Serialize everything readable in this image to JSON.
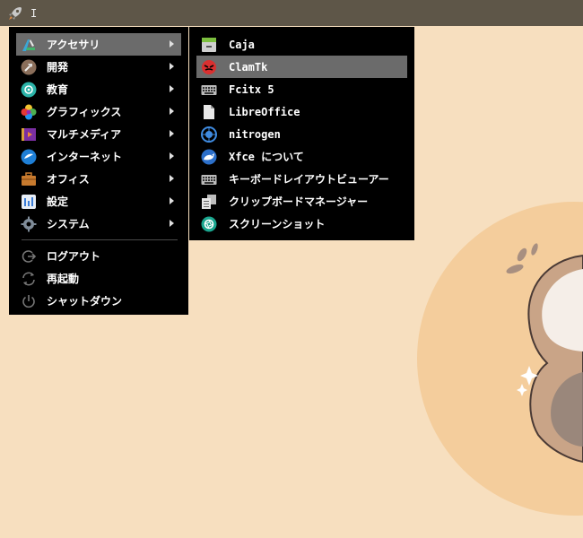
{
  "panel": {
    "launcher_icon": "rocket-icon",
    "cursor_text": "I"
  },
  "main_menu": {
    "items": [
      {
        "label": "アクセサリ",
        "icon": "accessories-icon",
        "submenu": true,
        "active": true
      },
      {
        "label": "開発",
        "icon": "development-icon",
        "submenu": true
      },
      {
        "label": "教育",
        "icon": "education-icon",
        "submenu": true
      },
      {
        "label": "グラフィックス",
        "icon": "graphics-icon",
        "submenu": true
      },
      {
        "label": "マルチメディア",
        "icon": "multimedia-icon",
        "submenu": true
      },
      {
        "label": "インターネット",
        "icon": "internet-icon",
        "submenu": true
      },
      {
        "label": "オフィス",
        "icon": "office-icon",
        "submenu": true
      },
      {
        "label": "設定",
        "icon": "settings-icon",
        "submenu": true
      },
      {
        "label": "システム",
        "icon": "system-icon",
        "submenu": true
      }
    ],
    "session": [
      {
        "label": "ログアウト",
        "icon": "logout-icon"
      },
      {
        "label": "再起動",
        "icon": "restart-icon"
      },
      {
        "label": "シャットダウン",
        "icon": "shutdown-icon"
      }
    ]
  },
  "sub_menu": {
    "items": [
      {
        "label": "Caja",
        "icon": "file-manager-icon"
      },
      {
        "label": "ClamTk",
        "icon": "clamtk-icon",
        "active": true
      },
      {
        "label": "Fcitx 5",
        "icon": "keyboard-icon"
      },
      {
        "label": "LibreOffice",
        "icon": "document-icon"
      },
      {
        "label": "nitrogen",
        "icon": "nitrogen-icon"
      },
      {
        "label": "Xfce について",
        "icon": "xfce-icon"
      },
      {
        "label": "キーボードレイアウトビューアー",
        "icon": "keyboard-icon"
      },
      {
        "label": "クリップボードマネージャー",
        "icon": "clipboard-icon"
      },
      {
        "label": "スクリーンショット",
        "icon": "screenshot-icon"
      }
    ]
  },
  "colors": {
    "panel": "#5e5648",
    "menu_bg": "#000000",
    "highlight": "#6b6b6b",
    "wallpaper": "#f7dfbf"
  }
}
